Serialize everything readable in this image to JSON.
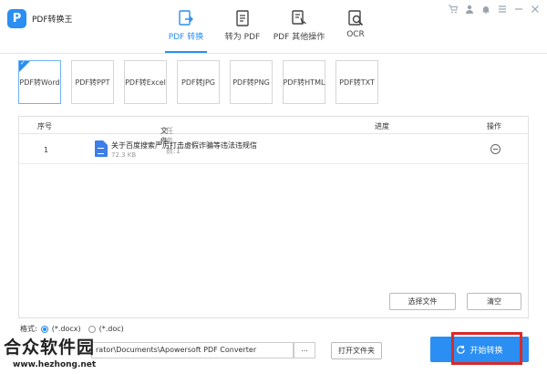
{
  "app": {
    "title": "PDF转换王",
    "logo_letter": "P"
  },
  "nav": [
    {
      "label": "PDF 转换",
      "icon": "pdf-convert-icon",
      "active": true
    },
    {
      "label": "转为 PDF",
      "icon": "to-pdf-icon",
      "active": false
    },
    {
      "label": "PDF 其他操作",
      "icon": "pdf-other-ops-icon",
      "active": false
    },
    {
      "label": "OCR",
      "icon": "ocr-icon",
      "active": false
    }
  ],
  "window_controls": [
    "cart-icon",
    "user-icon",
    "bell-icon",
    "menu-icon",
    "minimize-icon",
    "close-icon"
  ],
  "subtabs": [
    "PDF转Word",
    "PDF转PPT",
    "PDF转Excel",
    "PDF转JPG",
    "PDF转PNG",
    "PDF转HTML",
    "PDF转TXT"
  ],
  "table": {
    "headers": {
      "index": "序号",
      "file": "文件",
      "task_count": "任务数:1",
      "progress": "进度",
      "action": "操作"
    },
    "rows": [
      {
        "index": "1",
        "name": "关于百度搜索严厉打击虚假诈骗等违法违规信",
        "size": "72.3 KB"
      }
    ],
    "select_files": "选择文件",
    "clear": "清空"
  },
  "format": {
    "label": "格式:",
    "options": [
      "(*.docx)",
      "(*.doc)"
    ],
    "selected": "(*.docx)"
  },
  "output": {
    "path": "rator\\Documents\\Apowersoft PDF Converter",
    "browse": "...",
    "open_folder": "打开文件夹"
  },
  "start_button": "开始转换",
  "watermark": {
    "name": "合众软件园",
    "url": "www.hezhong.net"
  },
  "colors": {
    "accent": "#2a8ef2",
    "highlight_box": "#d92a2a"
  }
}
